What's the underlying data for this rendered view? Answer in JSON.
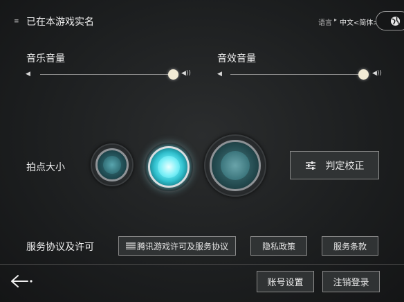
{
  "header": {
    "verified_text": "已在本游戏实名",
    "language_label": "语言",
    "language_value": "中文<简体>"
  },
  "audio": {
    "music_label": "音乐音量",
    "music_level": 0.92,
    "sfx_label": "音效音量",
    "sfx_level": 0.92
  },
  "note_size": {
    "label": "拍点大小",
    "options": [
      "small",
      "medium",
      "large"
    ],
    "selected": "medium",
    "calibrate_label": "判定校正"
  },
  "agreements": {
    "label": "服务协议及许可",
    "license_button": "腾讯游戏许可及服务协议",
    "privacy_button": "隐私政策",
    "terms_button": "服务条款"
  },
  "footer": {
    "account_settings": "账号设置",
    "logout": "注销登录"
  },
  "colors": {
    "accent_cyan": "#5ee6f2",
    "thumb": "#f1ead4"
  }
}
